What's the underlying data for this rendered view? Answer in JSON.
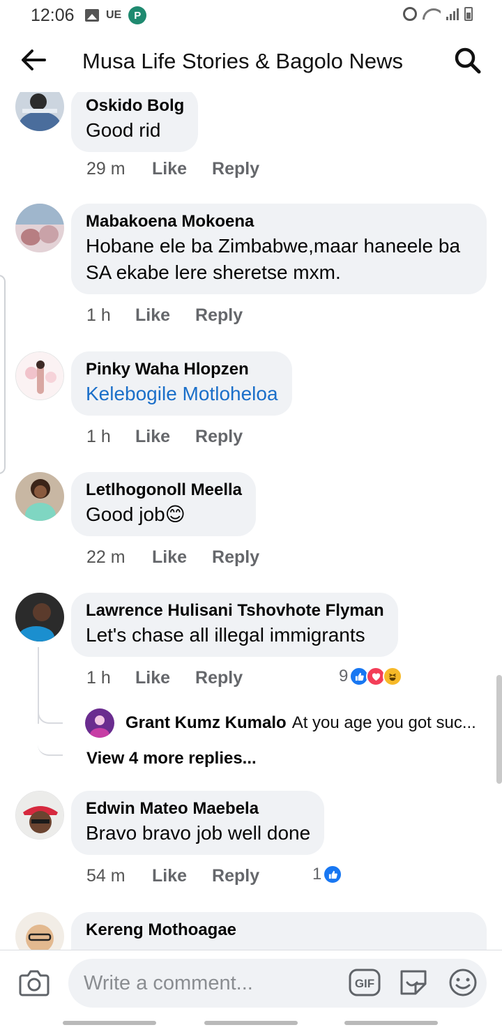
{
  "status_bar": {
    "time": "12:06",
    "ue_label": "UE",
    "app_badge": "P"
  },
  "header": {
    "title": "Musa Life Stories & Bagolo News"
  },
  "comments": [
    {
      "name": "Oskido Bolg",
      "text": "Good rid",
      "time": "29 m",
      "like_label": "Like",
      "reply_label": "Reply",
      "avatar_color": "#5d7fa8"
    },
    {
      "name": "Mabakoena Mokoena",
      "text": "Hobane ele ba Zimbabwe,maar haneele ba SA ekabe lere sheretse mxm.",
      "time": "1 h",
      "like_label": "Like",
      "reply_label": "Reply",
      "avatar_color": "#c99aa6"
    },
    {
      "name": "Pinky Waha Hlopzen",
      "text": "Kelebogile Motloheloa",
      "time": "1 h",
      "like_label": "Like",
      "reply_label": "Reply",
      "avatar_color": "#f1d9dc"
    },
    {
      "name": "Letlhogonoll Meella",
      "text": "Good job😊",
      "time": "22 m",
      "like_label": "Like",
      "reply_label": "Reply",
      "avatar_color": "#7a5a48"
    },
    {
      "name": "Lawrence Hulisani Tshovhote Flyman",
      "text": "Let's chase all illegal immigrants",
      "time": "1 h",
      "like_label": "Like",
      "reply_label": "Reply",
      "reaction_count": "9",
      "avatar_color": "#3a3a3a",
      "reply_preview": {
        "name": "Grant Kumz Kumalo",
        "text": "At you age you got suc..."
      },
      "view_more": "View 4 more replies..."
    },
    {
      "name": "Edwin Mateo Maebela",
      "text": "Bravo bravo job well done",
      "time": "54 m",
      "like_label": "Like",
      "reply_label": "Reply",
      "reaction_count": "1",
      "avatar_color": "#d9d9d4"
    },
    {
      "name": "Kereng Mothoagae",
      "avatar_color": "#e8c9a8"
    }
  ],
  "composer": {
    "placeholder": "Write a comment...",
    "gif_label": "GIF"
  },
  "colors": {
    "bubble": "#f0f2f5",
    "mention": "#1b6fc9",
    "meta": "#65676b",
    "like_blue": "#1877f2"
  }
}
